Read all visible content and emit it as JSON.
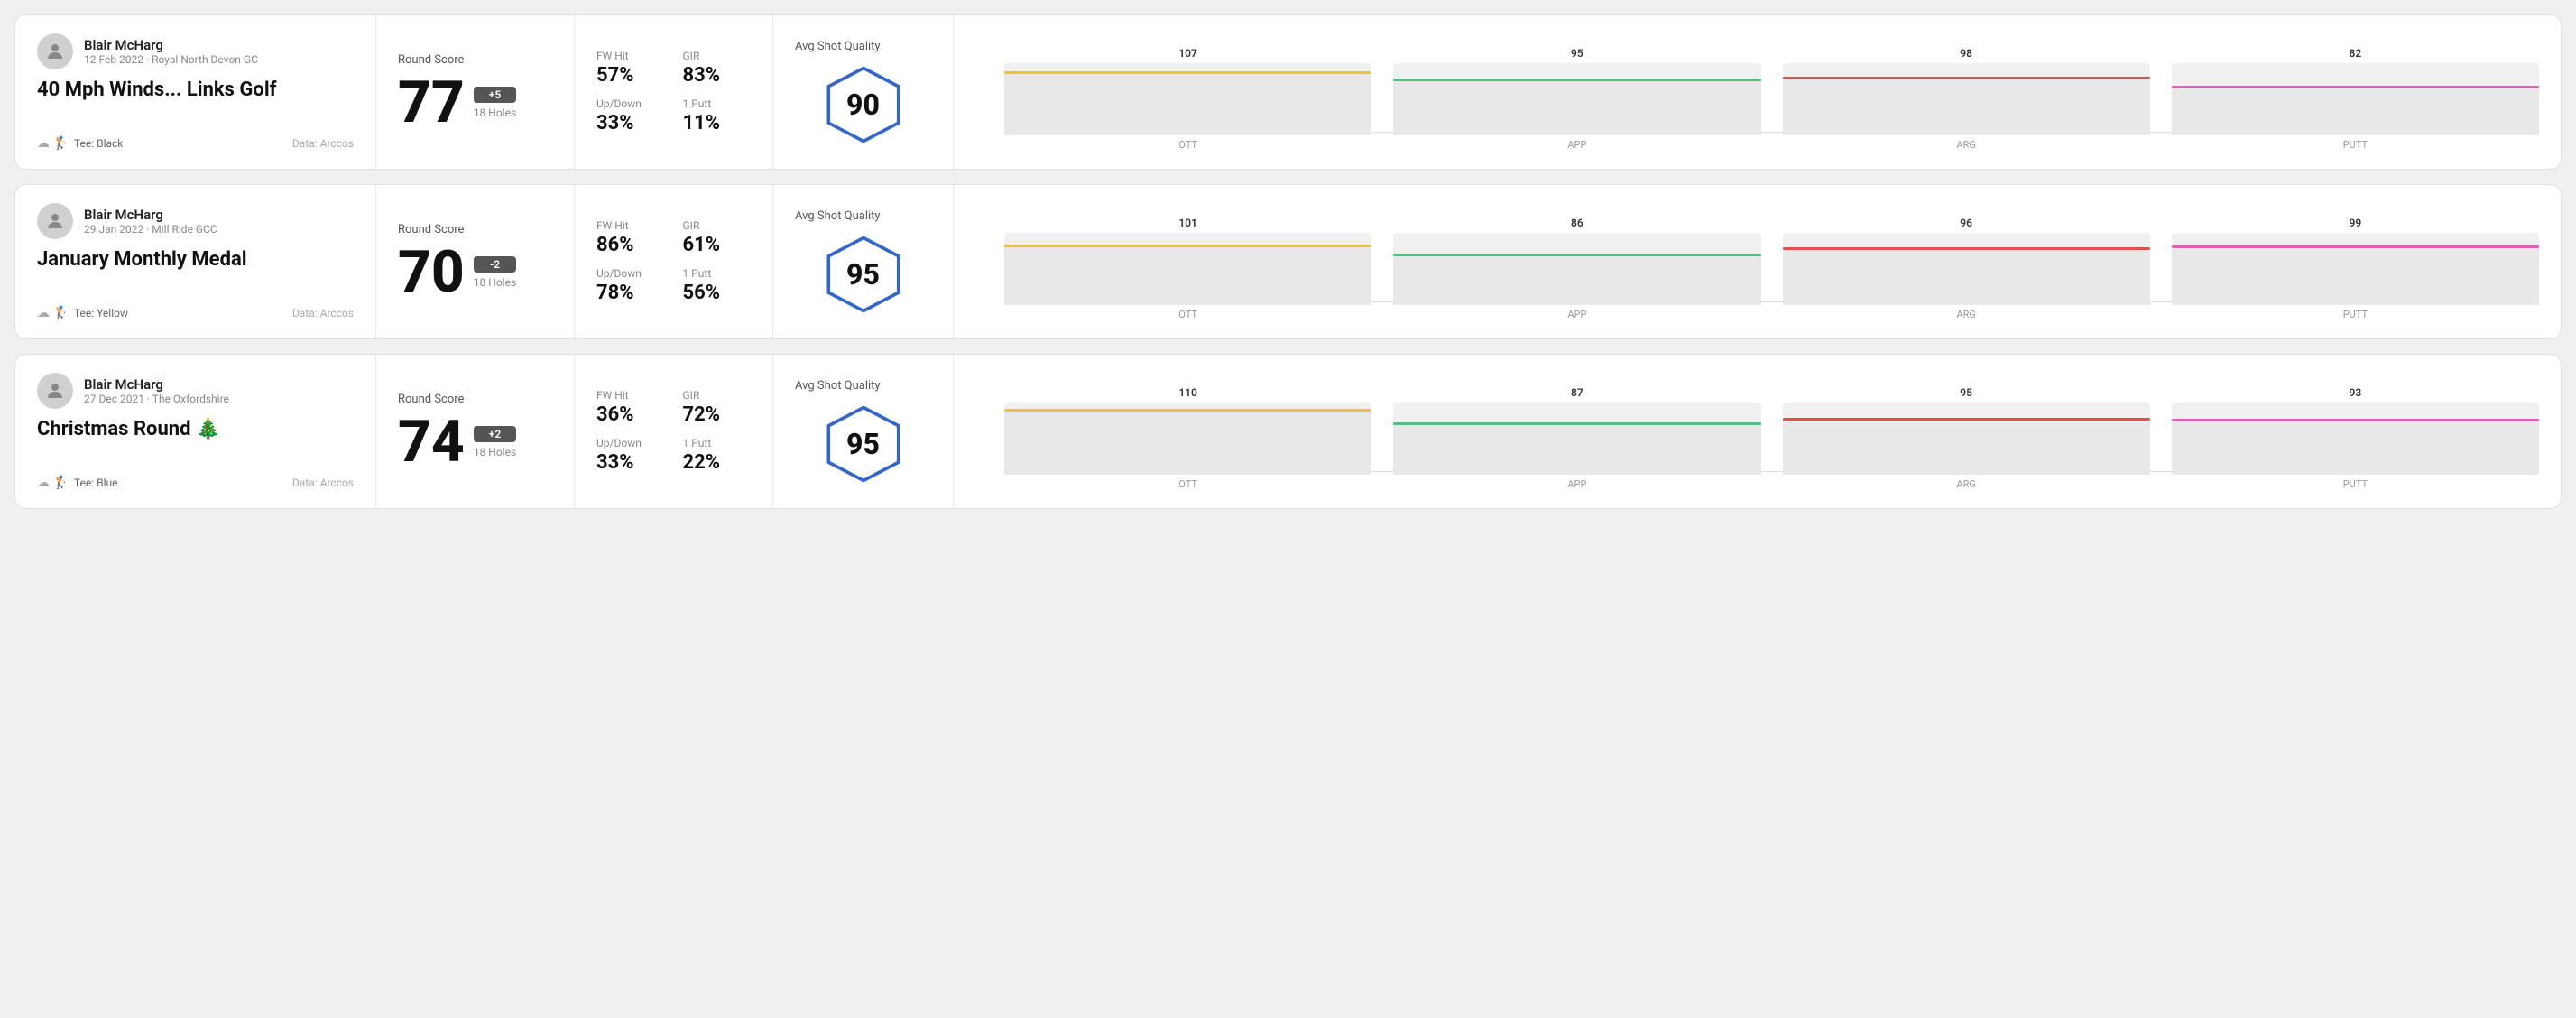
{
  "rounds": [
    {
      "id": "round-1",
      "user": {
        "name": "Blair McHarg",
        "date": "12 Feb 2022",
        "course": "Royal North Devon GC"
      },
      "title": "40 Mph Winds... Links Golf",
      "title_emoji": "🏌",
      "tee": "Black",
      "data_source": "Data: Arccos",
      "score": {
        "label": "Round Score",
        "number": "77",
        "badge": "+5",
        "holes": "18 Holes"
      },
      "stats": {
        "fw_hit_label": "FW Hit",
        "fw_hit_value": "57%",
        "gir_label": "GIR",
        "gir_value": "83%",
        "updown_label": "Up/Down",
        "updown_value": "33%",
        "oneputt_label": "1 Putt",
        "oneputt_value": "11%"
      },
      "quality": {
        "label": "Avg Shot Quality",
        "score": "90"
      },
      "chart": {
        "y_labels": [
          "100",
          "50",
          "0"
        ],
        "bars": [
          {
            "label": "OTT",
            "value": 107,
            "color": "#f0c040",
            "max": 120
          },
          {
            "label": "APP",
            "value": 95,
            "color": "#50c080",
            "max": 120
          },
          {
            "label": "ARG",
            "value": 98,
            "color": "#e05050",
            "max": 120
          },
          {
            "label": "PUTT",
            "value": 82,
            "color": "#e060b0",
            "max": 120
          }
        ]
      }
    },
    {
      "id": "round-2",
      "user": {
        "name": "Blair McHarg",
        "date": "29 Jan 2022",
        "course": "Mill Ride GCC"
      },
      "title": "January Monthly Medal",
      "title_emoji": "",
      "tee": "Yellow",
      "data_source": "Data: Arccos",
      "score": {
        "label": "Round Score",
        "number": "70",
        "badge": "-2",
        "holes": "18 Holes"
      },
      "stats": {
        "fw_hit_label": "FW Hit",
        "fw_hit_value": "86%",
        "gir_label": "GIR",
        "gir_value": "61%",
        "updown_label": "Up/Down",
        "updown_value": "78%",
        "oneputt_label": "1 Putt",
        "oneputt_value": "56%"
      },
      "quality": {
        "label": "Avg Shot Quality",
        "score": "95"
      },
      "chart": {
        "y_labels": [
          "100",
          "50",
          "0"
        ],
        "bars": [
          {
            "label": "OTT",
            "value": 101,
            "color": "#f0c040",
            "max": 120
          },
          {
            "label": "APP",
            "value": 86,
            "color": "#50c080",
            "max": 120
          },
          {
            "label": "ARG",
            "value": 96,
            "color": "#e05050",
            "max": 120
          },
          {
            "label": "PUTT",
            "value": 99,
            "color": "#e060b0",
            "max": 120
          }
        ]
      }
    },
    {
      "id": "round-3",
      "user": {
        "name": "Blair McHarg",
        "date": "27 Dec 2021",
        "course": "The Oxfordshire"
      },
      "title": "Christmas Round 🎄",
      "title_emoji": "",
      "tee": "Blue",
      "data_source": "Data: Arccos",
      "score": {
        "label": "Round Score",
        "number": "74",
        "badge": "+2",
        "holes": "18 Holes"
      },
      "stats": {
        "fw_hit_label": "FW Hit",
        "fw_hit_value": "36%",
        "gir_label": "GIR",
        "gir_value": "72%",
        "updown_label": "Up/Down",
        "updown_value": "33%",
        "oneputt_label": "1 Putt",
        "oneputt_value": "22%"
      },
      "quality": {
        "label": "Avg Shot Quality",
        "score": "95"
      },
      "chart": {
        "y_labels": [
          "100",
          "50",
          "0"
        ],
        "bars": [
          {
            "label": "OTT",
            "value": 110,
            "color": "#f0c040",
            "max": 120
          },
          {
            "label": "APP",
            "value": 87,
            "color": "#50c080",
            "max": 120
          },
          {
            "label": "ARG",
            "value": 95,
            "color": "#e05050",
            "max": 120
          },
          {
            "label": "PUTT",
            "value": 93,
            "color": "#e060b0",
            "max": 120
          }
        ]
      }
    }
  ]
}
